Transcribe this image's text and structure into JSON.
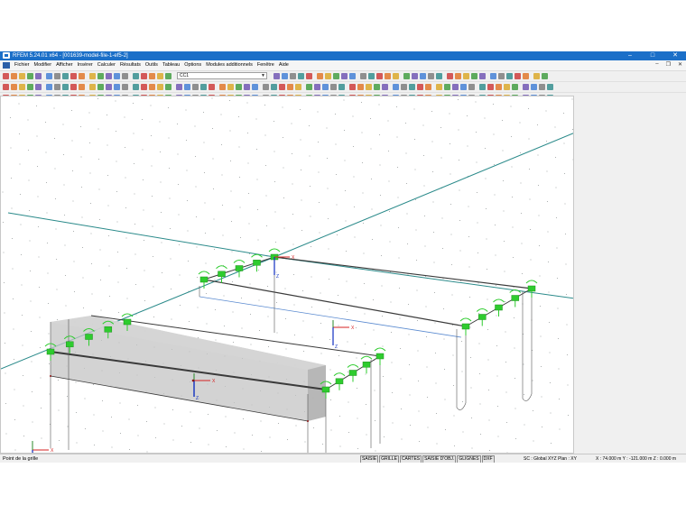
{
  "window": {
    "title": "RFEM 5.24.01 x64 - [001639-model-file-1-ef5-2]",
    "controls": [
      "–",
      "□",
      "✕"
    ]
  },
  "menu": {
    "items": [
      "Fichier",
      "Modifier",
      "Afficher",
      "Insérer",
      "Calculer",
      "Résultats",
      "Outils",
      "Tableau",
      "Options",
      "Modules additionnels",
      "Fenêtre",
      "Aide"
    ],
    "doc_controls": [
      "–",
      "❐",
      "✕"
    ]
  },
  "toolbar": {
    "load_case": "CC1"
  },
  "viewport": {
    "axis_labels": {
      "x": "X",
      "y": "Y",
      "z": "Z"
    },
    "colors": {
      "grid_dot": "#9aa0a0",
      "teal_line": "#2a8a8a",
      "member": "#3a3a3a",
      "support": "#2ecc2e",
      "support_dark": "#1f8f1f",
      "axis_x": "#d62020",
      "axis_z": "#1030c0",
      "solid_face": "#c4c4c4",
      "blue_line": "#5a8ad0"
    }
  },
  "status": {
    "hint": "Point de la grille",
    "toggles": [
      "SAISIE",
      "GRILLE",
      "CARTES",
      "SAISIE D'OBJ.",
      "GLIGNES",
      "DXF"
    ],
    "info": "SC : Global XYZ   Plan : XY",
    "coords": "X : 74.000 m   Y : -121.000 m   Z : 0.000 m"
  }
}
